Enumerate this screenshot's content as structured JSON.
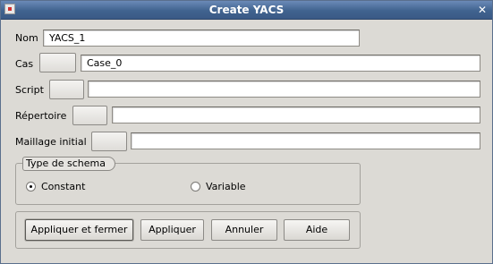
{
  "window": {
    "title": "Create YACS"
  },
  "form": {
    "nom": {
      "label": "Nom",
      "value": "YACS_1"
    },
    "cas": {
      "label": "Cas",
      "value": "Case_0"
    },
    "script": {
      "label": "Script",
      "value": ""
    },
    "repertoire": {
      "label": "Répertoire",
      "value": ""
    },
    "maillage": {
      "label": "Maillage initial",
      "value": ""
    }
  },
  "schema": {
    "title": "Type de schema",
    "options": [
      {
        "label": "Constant",
        "checked": true
      },
      {
        "label": "Variable",
        "checked": false
      }
    ]
  },
  "buttons": {
    "apply_close": "Appliquer et fermer",
    "apply": "Appliquer",
    "cancel": "Annuler",
    "help": "Aide"
  }
}
